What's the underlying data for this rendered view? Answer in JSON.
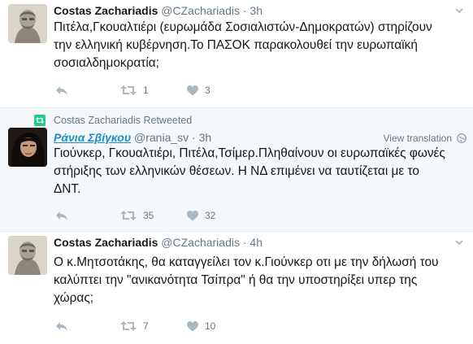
{
  "tweets": [
    {
      "name": "Costas Zachariadis",
      "handle": "@CZachariadis",
      "dot": "·",
      "time": "3h",
      "lines": [
        "Πιτέλα,Γκουαλτιέρι (ευρωμάδα Σοσιαλιστών-Δημοκρατών) στηρίζουν",
        "την ελληνική κυβέρνηση.Το ΠΑΣΟΚ παρακολουθεί την ευρωπαϊκή",
        "σοσιαλδημοκρατία;"
      ],
      "retweets": "1",
      "likes": "3"
    },
    {
      "retweet_context": "Costas Zachariadis Retweeted",
      "name": "Ράνια Σβίγκου",
      "handle": "@rania_sv",
      "dot": "·",
      "time": "3h",
      "translate": "View translation",
      "lines": [
        "Γιούνκερ, Γκουαλτιέρι, Πιτέλα,Τσίμερ.Πληθαίνουν οι ευρωπαϊκές φωνές",
        "στήριξης των ελληνικών θέσεων. Η ΝΔ επιμένει να ταυτίζεται με το",
        "ΔΝΤ."
      ],
      "retweets": "35",
      "likes": "32"
    },
    {
      "name": "Costas Zachariadis",
      "handle": "@CZachariadis",
      "dot": "·",
      "time": "4h",
      "lines": [
        "Ο κ.Μητσοτάκης, θα καταγγείλει τον κ.Γιούνκερ οτι με την δήλωσή του",
        "καλύπτει την \"ανικανότητα Τσίπρα\" ή θα την υποστηρίξει υπερ της",
        "χώρας;"
      ],
      "retweets": "7",
      "likes": "10"
    }
  ],
  "colors": {
    "accent": "#1b8ec8",
    "retweet_green": "#19cf86",
    "muted": "#657786",
    "icon": "#aab8c2",
    "highlight_bg": "#f5f8fa"
  },
  "icons": {
    "reply": "reply-icon",
    "retweet": "retweet-icon",
    "like": "heart-icon",
    "more": "chevron-down-icon",
    "globe": "globe-icon"
  }
}
